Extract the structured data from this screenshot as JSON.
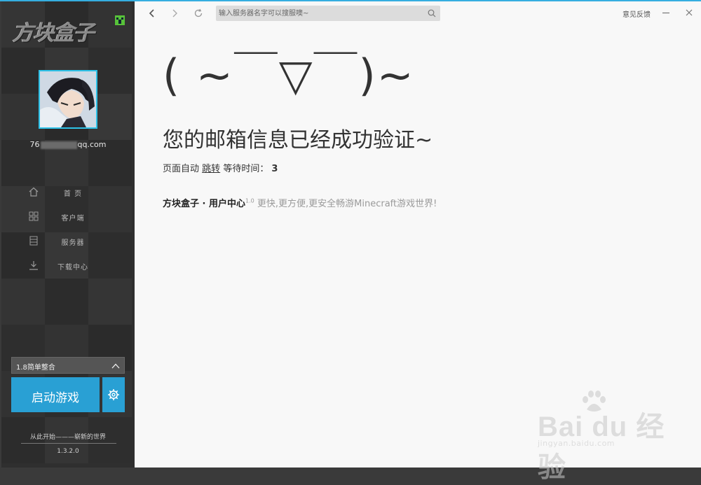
{
  "sidebar": {
    "logo_text": "方块盒子",
    "email_prefix": "76",
    "email_suffix": "qq.com",
    "nav": [
      {
        "label": "首  页",
        "icon": "home-icon"
      },
      {
        "label": "客户端",
        "icon": "grid-icon"
      },
      {
        "label": "服务器",
        "icon": "server-icon"
      },
      {
        "label": "下载中心",
        "icon": "download-icon"
      }
    ],
    "version_select": "1.8简单整合",
    "launch_label": "启动游戏",
    "slogan": "从此开始———崭新的世界",
    "app_version": "1.3.2.0"
  },
  "toolbar": {
    "search_placeholder": "输入服务器名字可以搜服噢~",
    "feedback": "意见反馈"
  },
  "content": {
    "kaomoji": "( ~￣▽￣)~",
    "headline": "您的邮箱信息已经成功验证~",
    "redirect_text": "页面自动",
    "redirect_link": "跳转",
    "wait_label": "等待时间：",
    "countdown": "3",
    "brand": "方块盒子 · 用户中心",
    "brand_version": "1.0",
    "tagline": "更快,更方便,更安全畅游Minecraft游戏世界!"
  },
  "watermark": {
    "main": "Bai du 经验",
    "url": "jingyan.baidu.com"
  },
  "colors": {
    "accent": "#29a0d4",
    "sidebar_bg": "#2f2f2f",
    "main_bg": "#f8f8f8"
  }
}
